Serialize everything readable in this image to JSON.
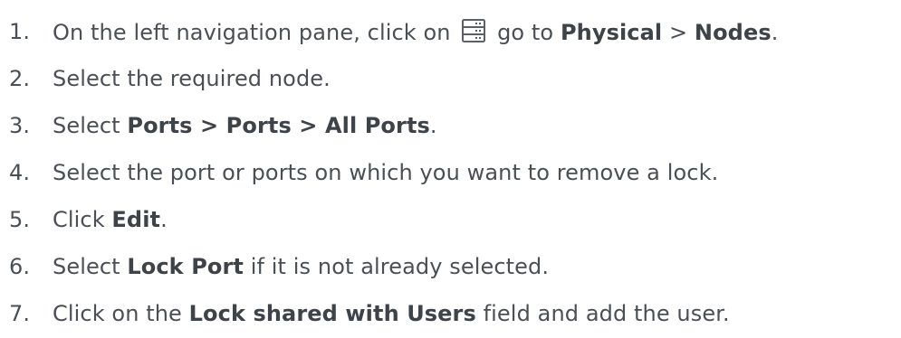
{
  "steps": [
    {
      "number": "1.",
      "parts": [
        {
          "text": "On the left navigation pane, click on ",
          "bold": false
        },
        {
          "icon": "server-nodes-icon"
        },
        {
          "text": " go to ",
          "bold": false
        },
        {
          "text": "Physical",
          "bold": true
        },
        {
          "text": " > ",
          "bold": false
        },
        {
          "text": "Nodes",
          "bold": true
        },
        {
          "text": ".",
          "bold": false
        }
      ]
    },
    {
      "number": "2.",
      "parts": [
        {
          "text": "Select the required node.",
          "bold": false
        }
      ]
    },
    {
      "number": "3.",
      "parts": [
        {
          "text": "Select ",
          "bold": false
        },
        {
          "text": "Ports > Ports > All Ports",
          "bold": true
        },
        {
          "text": ".",
          "bold": false
        }
      ]
    },
    {
      "number": "4.",
      "parts": [
        {
          "text": "Select the port or ports on which you want to remove a lock.",
          "bold": false
        }
      ]
    },
    {
      "number": "5.",
      "parts": [
        {
          "text": "Click ",
          "bold": false
        },
        {
          "text": "Edit",
          "bold": true
        },
        {
          "text": ".",
          "bold": false
        }
      ]
    },
    {
      "number": "6.",
      "parts": [
        {
          "text": "Select ",
          "bold": false
        },
        {
          "text": "Lock Port",
          "bold": true
        },
        {
          "text": " if it is not already selected.",
          "bold": false
        }
      ]
    },
    {
      "number": "7.",
      "parts": [
        {
          "text": "Click on the ",
          "bold": false
        },
        {
          "text": "Lock shared with Users",
          "bold": true
        },
        {
          "text": " field and add the user.",
          "bold": false
        }
      ]
    }
  ],
  "colors": {
    "text": "#4a4f55",
    "icon": "#5b6068"
  }
}
